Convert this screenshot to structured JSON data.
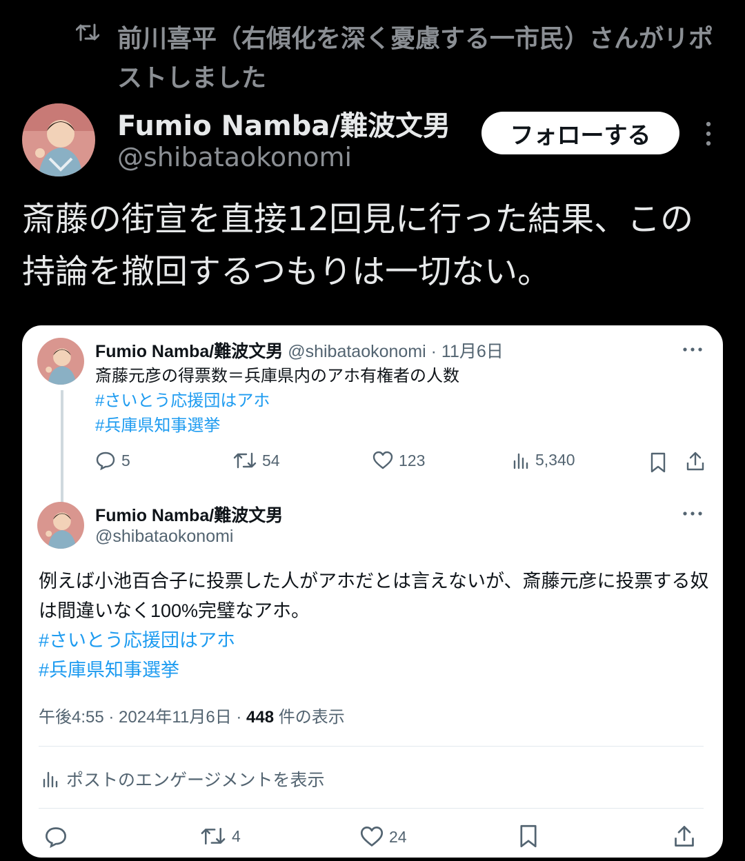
{
  "repost": {
    "text": "前川喜平（右傾化を深く憂慮する一市民）さんがリポストしました",
    "icon": "repost-icon"
  },
  "post": {
    "author_name": "Fumio Namba/難波文男",
    "author_handle": "@shibataokonomi",
    "follow_label": "フォローする",
    "text": "斎藤の街宣を直接12回見に行った結果、この持論を撤回するつもりは一切ない。"
  },
  "quoted": {
    "parent": {
      "author_name": "Fumio Namba/難波文男",
      "handle_date": "@shibataokonomi · 11月6日",
      "text": "斎藤元彦の得票数＝兵庫県内のアホ有権者の人数",
      "hashtags": [
        "#さいとう応援団はアホ",
        "#兵庫県知事選挙"
      ],
      "replies": "5",
      "reposts": "54",
      "likes": "123",
      "views": "5,340"
    },
    "reply": {
      "author_name": "Fumio Namba/難波文男",
      "author_handle": "@shibataokonomi",
      "text": "例えば小池百合子に投票した人がアホだとは言えないが、斎藤元彦に投票する奴は間違いなく100%完璧なアホ。",
      "hashtags": [
        "#さいとう応援団はアホ",
        "#兵庫県知事選挙"
      ],
      "time": "午後4:55 · 2024年11月6日 · ",
      "view_count": "448",
      "view_suffix": " 件の表示",
      "engagement_label": "ポストのエンゲージメントを表示",
      "reposts": "4",
      "likes": "24"
    }
  },
  "colors": {
    "background": "#000000",
    "link": "#1d9bf0",
    "muted": "#8b8f94",
    "card": "#ffffff"
  }
}
